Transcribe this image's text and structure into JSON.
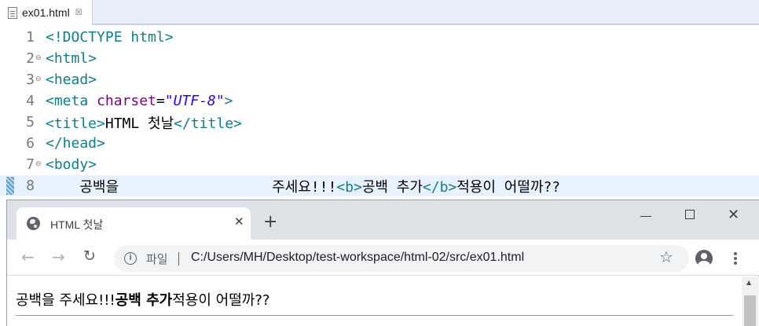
{
  "editor": {
    "tab": {
      "filename": "ex01.html",
      "close": "☒"
    },
    "lines": [
      {
        "num": "1",
        "fold": "",
        "segments": [
          {
            "cls": "tag",
            "text": "<!DOCTYPE html>"
          }
        ]
      },
      {
        "num": "2",
        "fold": "⊖",
        "segments": [
          {
            "cls": "tag",
            "text": "<html>"
          }
        ]
      },
      {
        "num": "3",
        "fold": "⊖",
        "segments": [
          {
            "cls": "tag",
            "text": "<head>"
          }
        ]
      },
      {
        "num": "4",
        "fold": "",
        "segments": [
          {
            "cls": "tag",
            "text": "<meta "
          },
          {
            "cls": "attr",
            "text": "charset"
          },
          {
            "cls": "plain",
            "text": "="
          },
          {
            "cls": "val",
            "text": "\"UTF-8\""
          },
          {
            "cls": "tag",
            "text": ">"
          }
        ]
      },
      {
        "num": "5",
        "fold": "",
        "segments": [
          {
            "cls": "tag",
            "text": "<title>"
          },
          {
            "cls": "plain",
            "text": "HTML 첫날"
          },
          {
            "cls": "tag",
            "text": "</title>"
          }
        ]
      },
      {
        "num": "6",
        "fold": "",
        "segments": [
          {
            "cls": "tag",
            "text": "</head>"
          }
        ]
      },
      {
        "num": "7",
        "fold": "⊖",
        "segments": [
          {
            "cls": "tag",
            "text": "<body>"
          }
        ]
      },
      {
        "num": "8",
        "fold": "",
        "active": true,
        "segments": [
          {
            "cls": "plain",
            "text": "    공백을                  주세요!!!"
          },
          {
            "cls": "tag",
            "text": "<b>"
          },
          {
            "cls": "plain",
            "text": "공백 추가"
          },
          {
            "cls": "tag",
            "text": "</b>"
          },
          {
            "cls": "plain",
            "text": "적용이 어떨까??"
          }
        ]
      }
    ]
  },
  "browser": {
    "tab_title": "HTML 첫날",
    "tab_close": "✕",
    "new_tab": "+",
    "window": {
      "minimize": "—",
      "maximize": "☐",
      "close": "✕"
    },
    "toolbar": {
      "back": "←",
      "forward": "→",
      "reload": "↻",
      "info": "i",
      "scheme_label": "파일",
      "url": "C:/Users/MH/Desktop/test-workspace/html-02/src/ex01.html",
      "star": "☆"
    },
    "page": {
      "before_bold": "공백을 주세요!!!",
      "bold": "공백 추가",
      "after_bold": "적용이 어떨까??"
    }
  },
  "colors": {
    "tag": "#0d7f8c",
    "attribute": "#7f007f",
    "value": "#2a00ff",
    "active_line": "#e8f2fe",
    "titlebar": "#dee1e6",
    "omnibox": "#f1f3f4"
  },
  "icons": [
    "file-icon",
    "close-icon",
    "globe-icon",
    "plus-icon",
    "minimize-icon",
    "maximize-icon",
    "back-arrow-icon",
    "forward-arrow-icon",
    "reload-icon",
    "info-icon",
    "star-icon",
    "profile-icon",
    "menu-dots-icon"
  ]
}
